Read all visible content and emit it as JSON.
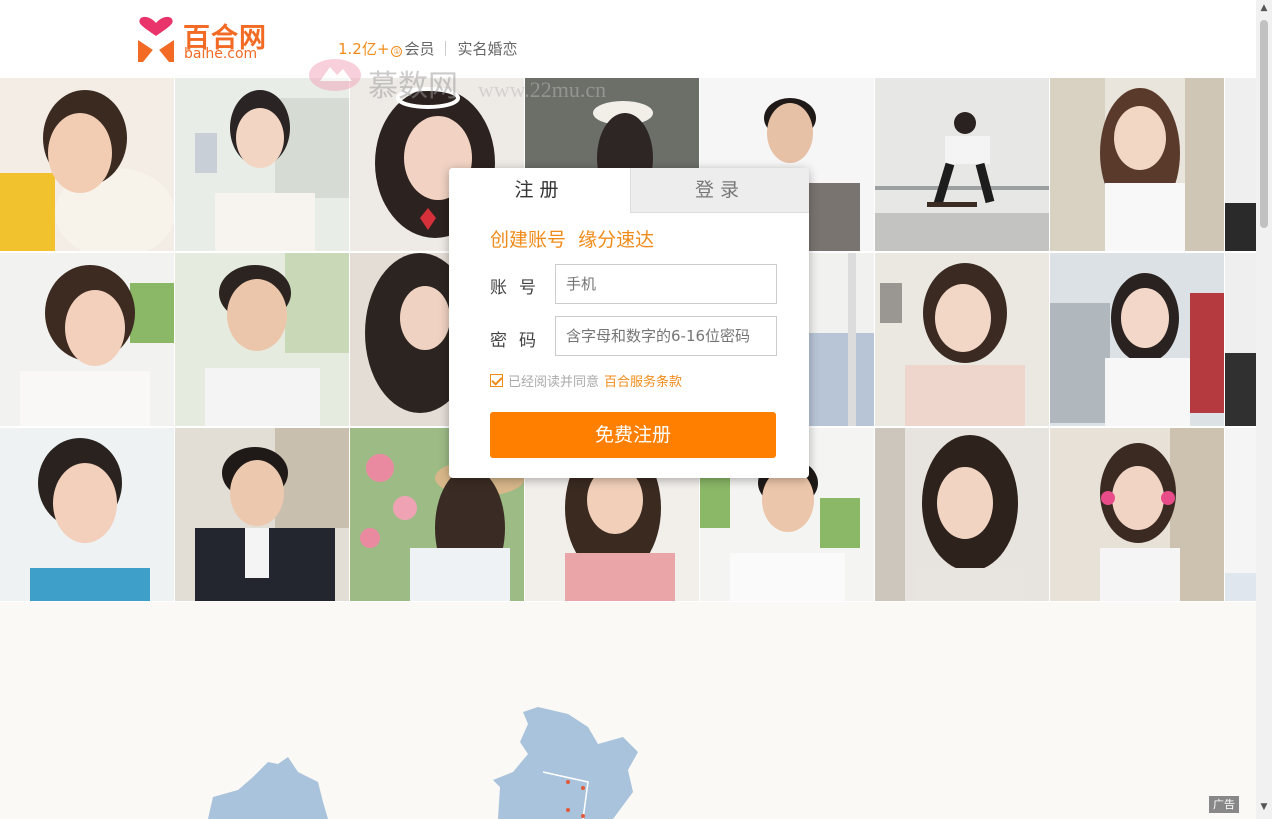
{
  "header": {
    "logo_cn": "百合网",
    "logo_en": "baihe.com",
    "member_count": "1.2亿+",
    "info_icon": "①",
    "member_label": "会员",
    "realname_label": "实名婚恋"
  },
  "watermark": {
    "text_cn": "慕数网",
    "url": "www.22mu.cn"
  },
  "panel": {
    "tabs": [
      {
        "label": "注册",
        "active": true
      },
      {
        "label": "登录",
        "active": false
      }
    ],
    "slogan": "创建账号  缘分速达",
    "account": {
      "label": "账号",
      "placeholder": "手机"
    },
    "password": {
      "label": "密码",
      "placeholder": "含字母和数字的6-16位密码"
    },
    "agree_text": "已经阅读并同意",
    "agree_link": "百合服务条款",
    "agree_checked": true,
    "submit_label": "免费注册"
  },
  "photos": {
    "count": 21
  },
  "ad_badge": "广告",
  "colors": {
    "brand_orange": "#ff7f00",
    "accent_orange": "#f08b1a",
    "logo_pink": "#e8336b",
    "logo_orange": "#f26a24"
  },
  "scrollbar": {
    "up_icon": "▲",
    "down_icon": "▼"
  }
}
